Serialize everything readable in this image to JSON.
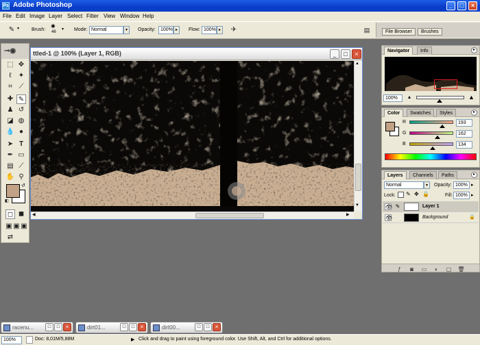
{
  "app": {
    "title": "Adobe Photoshop",
    "icon_text": "Ps"
  },
  "menu": [
    "File",
    "Edit",
    "Image",
    "Layer",
    "Select",
    "Filter",
    "View",
    "Window",
    "Help"
  ],
  "options": {
    "brush_label": "Brush:",
    "brush_size": "46",
    "mode_label": "Mode:",
    "mode_value": "Normal",
    "opacity_label": "Opacity:",
    "opacity_value": "100%",
    "flow_label": "Flow:",
    "flow_value": "100%"
  },
  "palette_well": {
    "tabs": [
      "File Browser",
      "Brushes"
    ]
  },
  "document": {
    "title": "ttled-1 @ 100% (Layer 1, RGB)"
  },
  "navigator": {
    "tabs": [
      "Navigator",
      "Info"
    ],
    "zoom": "100%"
  },
  "color": {
    "tabs": [
      "Color",
      "Swatches",
      "Styles"
    ],
    "channels": [
      {
        "label": "R",
        "value": "193",
        "level": 0.757
      },
      {
        "label": "G",
        "value": "162",
        "level": 0.635
      },
      {
        "label": "B",
        "value": "134",
        "level": 0.525
      }
    ],
    "foreground": "#c1a286",
    "background": "#ffffff"
  },
  "layers": {
    "tabs": [
      "Layers",
      "Channels",
      "Paths"
    ],
    "blend_mode": "Normal",
    "opacity_label": "Opacity:",
    "opacity_value": "100%",
    "lock_label": "Lock:",
    "fill_label": "Fill:",
    "fill_value": "100%",
    "items": [
      {
        "name": "Layer 1",
        "selected": true
      },
      {
        "name": "Background",
        "selected": false
      }
    ]
  },
  "taskbar": {
    "windows": [
      "racenu...",
      "dirt01...",
      "dirt00..."
    ]
  },
  "status": {
    "zoom": "100%",
    "doc_info": "Doc: 8,01M/5,88M",
    "hint": "Click and drag to paint using foreground color.  Use Shift, Alt, and Ctrl for additional options."
  },
  "colors": {
    "titlebar": "#0a3cc8",
    "chrome": "#ece9d8",
    "workspace": "#6f6f6f",
    "accent_red": "#e02020"
  }
}
